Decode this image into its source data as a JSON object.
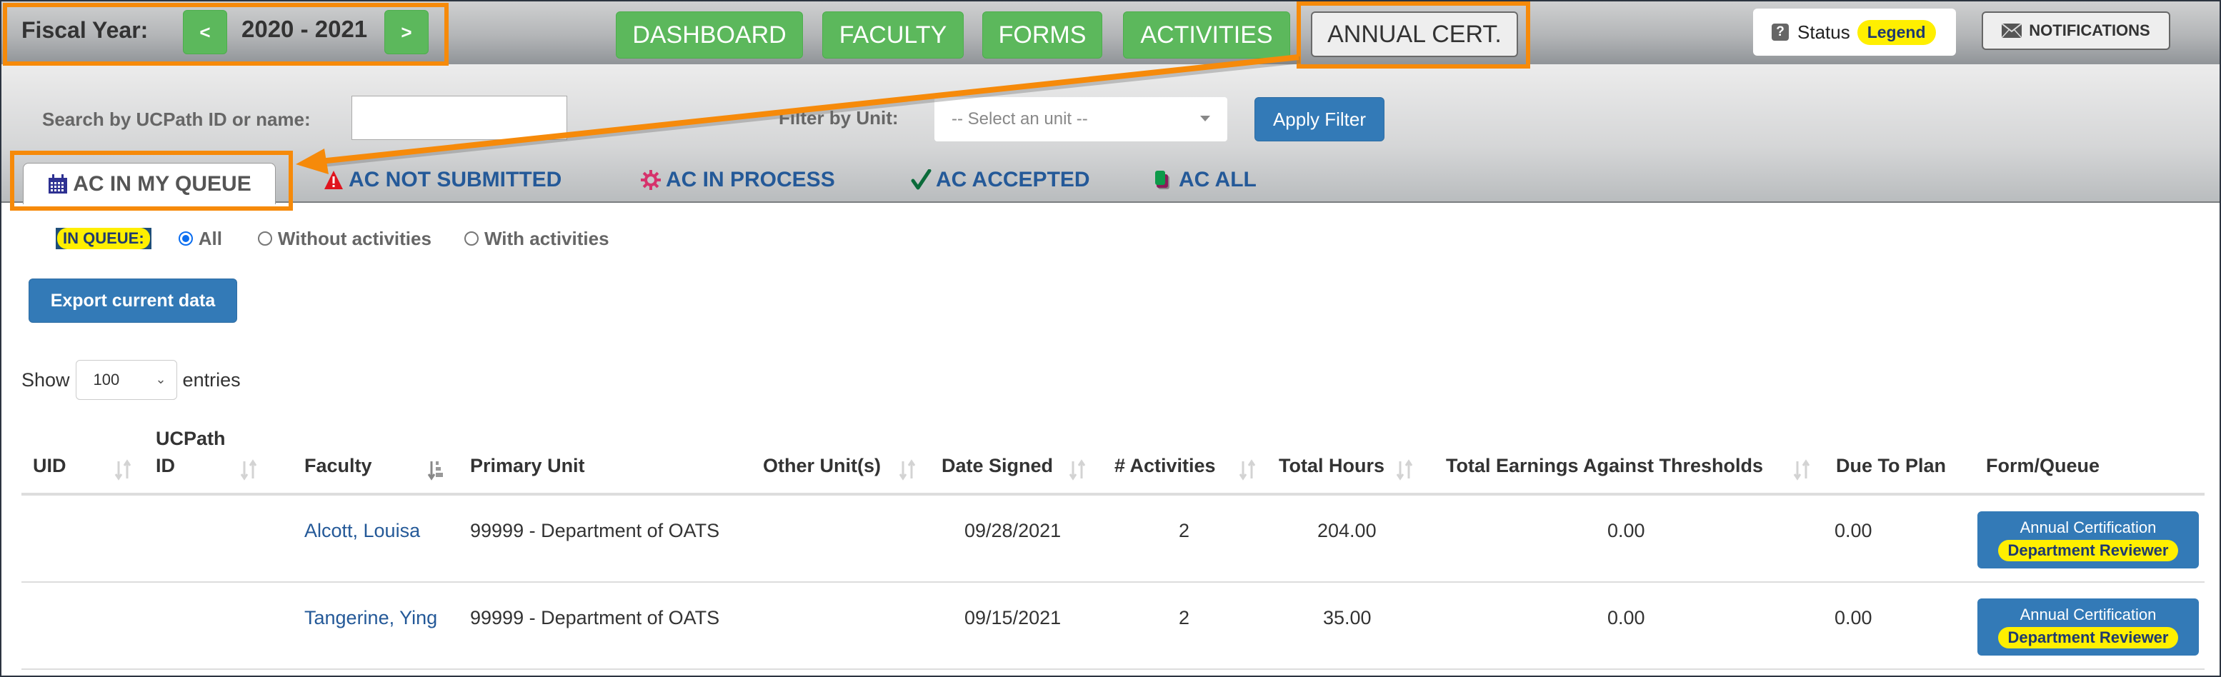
{
  "header": {
    "fiscal_year_label": "Fiscal Year:",
    "fiscal_year_value": "2020 - 2021",
    "prev_label": "<",
    "next_label": ">",
    "nav": [
      {
        "label": "DASHBOARD",
        "active": false
      },
      {
        "label": "FACULTY",
        "active": false
      },
      {
        "label": "FORMS",
        "active": false
      },
      {
        "label": "ACTIVITIES",
        "active": false
      },
      {
        "label": "ANNUAL CERT.",
        "active": true
      }
    ],
    "status_label": "Status",
    "legend_label": "Legend",
    "notifications_label": "NOTIFICATIONS"
  },
  "filters": {
    "search_label": "Search by UCPath ID or name:",
    "search_value": "",
    "unit_label": "Filter by Unit:",
    "unit_placeholder": "-- Select an unit --",
    "apply_label": "Apply Filter"
  },
  "tabs": [
    {
      "label": "AC IN MY QUEUE",
      "icon": "calendar-icon",
      "active": true
    },
    {
      "label": "AC NOT SUBMITTED",
      "icon": "warning-icon",
      "active": false
    },
    {
      "label": "AC IN PROCESS",
      "icon": "gear-icon",
      "active": false
    },
    {
      "label": "AC ACCEPTED",
      "icon": "checkmark-icon",
      "active": false
    },
    {
      "label": "AC ALL",
      "icon": "stack-icon",
      "active": false
    }
  ],
  "queue_filter": {
    "badge": "IN QUEUE:",
    "options": [
      {
        "label": "All",
        "checked": true
      },
      {
        "label": "Without activities",
        "checked": false
      },
      {
        "label": "With activities",
        "checked": false
      }
    ]
  },
  "export_label": "Export current data",
  "length": {
    "show_label": "Show",
    "value": "100",
    "entries_label": "entries"
  },
  "table": {
    "columns": [
      {
        "label": "UID",
        "sortable": true
      },
      {
        "label": "UCPath ID",
        "line1": "UCPath",
        "line2": "ID",
        "sortable": true
      },
      {
        "label": "Faculty",
        "sortable": true,
        "sorted": "asc"
      },
      {
        "label": "Primary Unit",
        "sortable": false
      },
      {
        "label": "Other Unit(s)",
        "sortable": true
      },
      {
        "label": "Date Signed",
        "sortable": true
      },
      {
        "label": "# Activities",
        "sortable": true
      },
      {
        "label": "Total Hours",
        "sortable": true
      },
      {
        "label": "Total Earnings Against Thresholds",
        "sortable": true
      },
      {
        "label": "Due To Plan",
        "sortable": false
      },
      {
        "label": "Form/Queue",
        "sortable": false
      }
    ],
    "rows": [
      {
        "uid": "",
        "ucpath_id": "",
        "faculty": "Alcott, Louisa",
        "primary_unit": "99999 - Department of OATS",
        "other_units": "",
        "date_signed": "09/28/2021",
        "activities": "2",
        "total_hours": "204.00",
        "total_earnings": "0.00",
        "due_to_plan": "0.00",
        "form": "Annual Certification",
        "queue": "Department Reviewer"
      },
      {
        "uid": "",
        "ucpath_id": "",
        "faculty": "Tangerine, Ying",
        "primary_unit": "99999 - Department of OATS",
        "other_units": "",
        "date_signed": "09/15/2021",
        "activities": "2",
        "total_hours": "35.00",
        "total_earnings": "0.00",
        "due_to_plan": "0.00",
        "form": "Annual Certification",
        "queue": "Department Reviewer"
      }
    ]
  },
  "colors": {
    "green_button": "#5cb85c",
    "primary_blue": "#337ab7",
    "link_blue": "#245998",
    "highlight_yellow": "#ffef00",
    "annotation_orange": "#f68a0a"
  }
}
